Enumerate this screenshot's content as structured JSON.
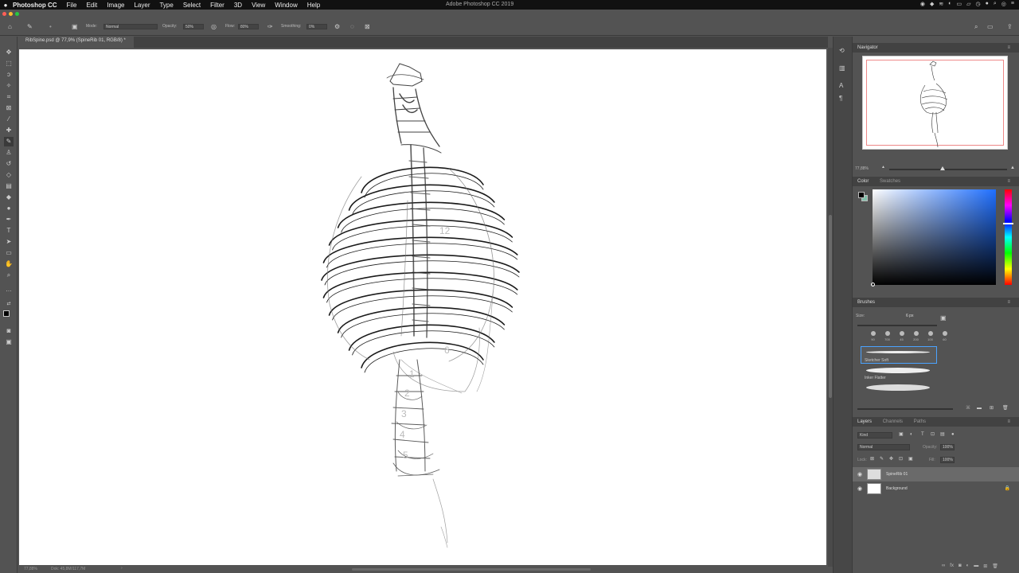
{
  "menubar": {
    "apple_icon": "apple-icon",
    "app": "Photoshop CC",
    "items": [
      "File",
      "Edit",
      "Image",
      "Layer",
      "Type",
      "Select",
      "Filter",
      "3D",
      "View",
      "Window",
      "Help"
    ],
    "window_title": "Adobe Photoshop CC 2019"
  },
  "options": {
    "mode_label": "Mode:",
    "mode_value": "Normal",
    "opacity_label": "Opacity:",
    "opacity_value": "50%",
    "flow_label": "Flow:",
    "flow_value": "80%",
    "smoothing_label": "Smoothing:",
    "smoothing_value": "0%"
  },
  "document": {
    "tab_label": "RibSpine.psd @ 77,9% (SpineRib 01, RGB/8) *",
    "canvas_digits": [
      "12",
      "6",
      "1",
      "2",
      "3",
      "4",
      "5"
    ]
  },
  "status": {
    "zoom": "77,88%",
    "doc": "Dok: 45,8M/117,7M"
  },
  "navigator": {
    "title": "Navigator",
    "zoom": "77,88%"
  },
  "color": {
    "tab_color": "Color",
    "tab_swatches": "Swatches",
    "foreground": "#000000",
    "background": "#7fbfa8",
    "hue_color": "#1f6fff"
  },
  "brushes": {
    "title": "Brushes",
    "size_label": "Size:",
    "size_value": "6 px",
    "presets": [
      "90",
      "700",
      "45",
      "200",
      "100",
      "60"
    ],
    "items": [
      "Sketcher Soft",
      "Inker Flatter"
    ]
  },
  "layers": {
    "tab_layers": "Layers",
    "tab_channels": "Channels",
    "tab_paths": "Paths",
    "kind": "Kind",
    "blend": "Normal",
    "opacity_label": "Opacity:",
    "opacity_value": "100%",
    "lock_label": "Lock:",
    "fill_label": "Fill:",
    "fill_value": "100%",
    "rows": [
      {
        "name": "SpineRib 01",
        "selected": true
      },
      {
        "name": "Background",
        "selected": false
      }
    ]
  }
}
